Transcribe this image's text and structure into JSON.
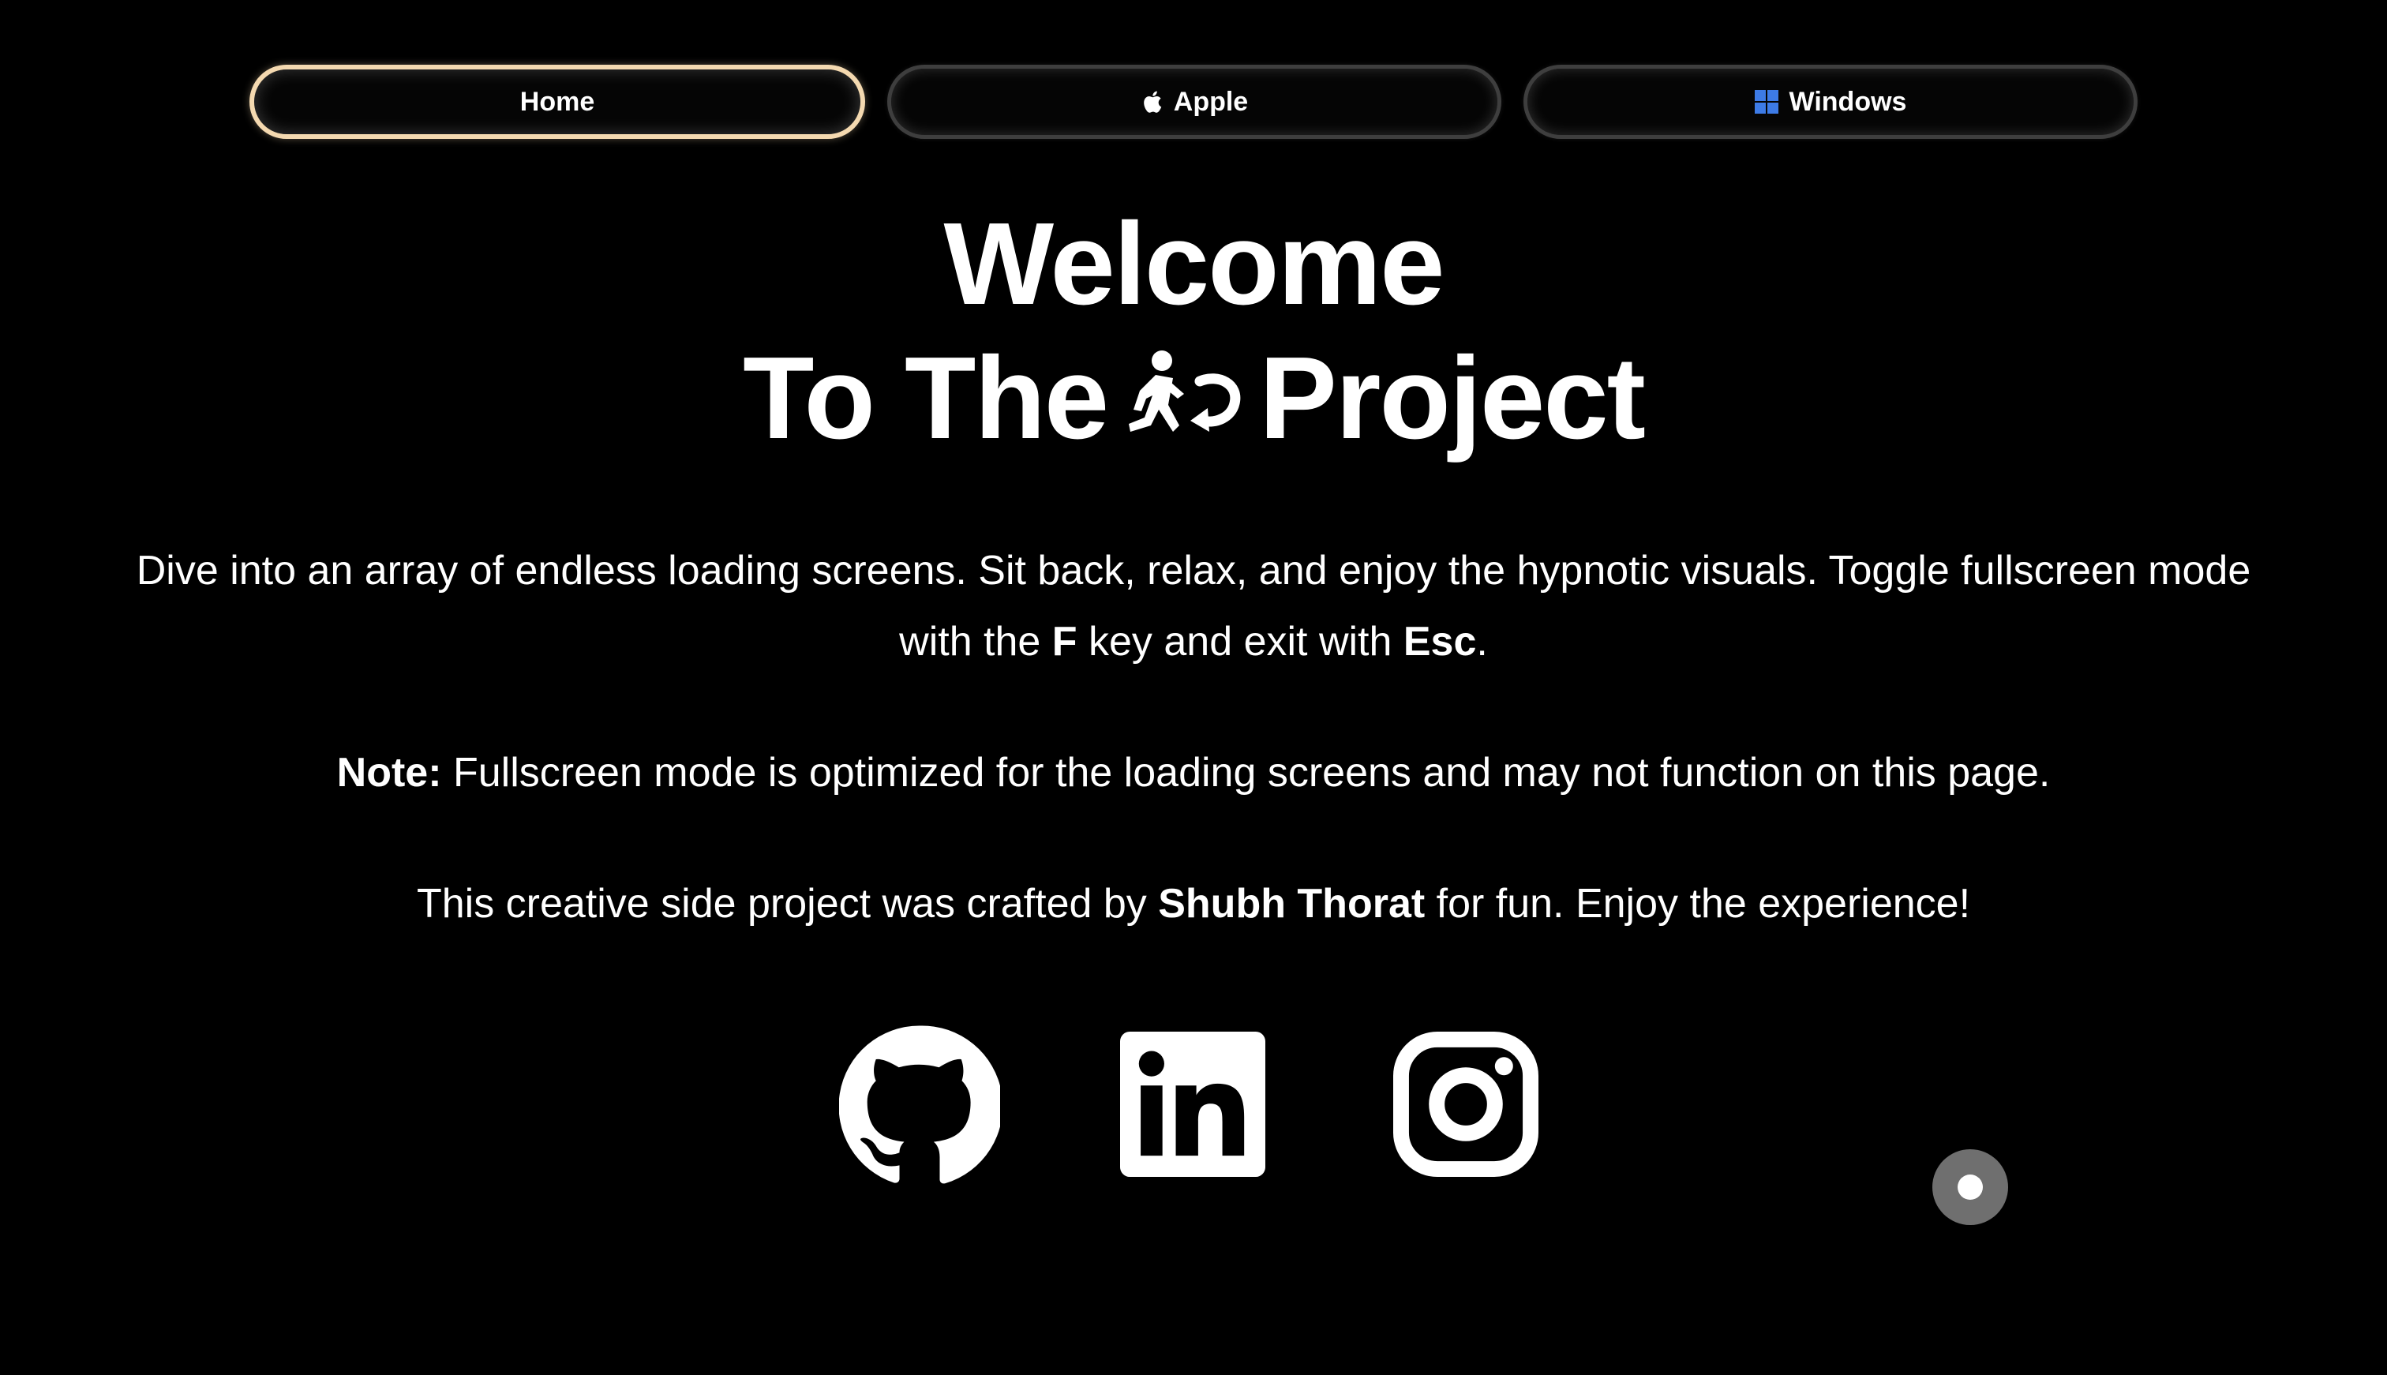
{
  "nav": {
    "items": [
      {
        "label": "Home",
        "icon": "",
        "active": true
      },
      {
        "label": "Apple",
        "icon": "apple-icon",
        "active": false
      },
      {
        "label": "Windows",
        "icon": "windows-icon",
        "active": false
      }
    ]
  },
  "heading": {
    "line1": "Welcome",
    "line2_before": "To The",
    "line2_icon": "running-person-loop-icon",
    "line2_after": "Project"
  },
  "intro": {
    "text_1": "Dive into an array of endless loading screens. Sit back, relax, and enjoy the hypnotic visuals. Toggle fullscreen mode with the ",
    "key_f": "F",
    "text_2": " key and exit with ",
    "key_esc": "Esc",
    "text_3": "."
  },
  "note": {
    "label": "Note:",
    "text": " Fullscreen mode is optimized for the loading screens and may not function on this page."
  },
  "credit": {
    "text_1": "This creative side project was crafted by ",
    "author": "Shubh Thorat",
    "text_2": " for fun. Enjoy the experience!"
  },
  "socials": [
    {
      "name": "GitHub",
      "icon": "github-icon"
    },
    {
      "name": "LinkedIn",
      "icon": "linkedin-icon"
    },
    {
      "name": "Instagram",
      "icon": "instagram-icon"
    }
  ],
  "colors": {
    "background": "#000000",
    "text": "#ffffff",
    "active_border": "#f4d9b0",
    "windows_blue": "#3d7be6",
    "float_button": "#6f6f6f"
  }
}
